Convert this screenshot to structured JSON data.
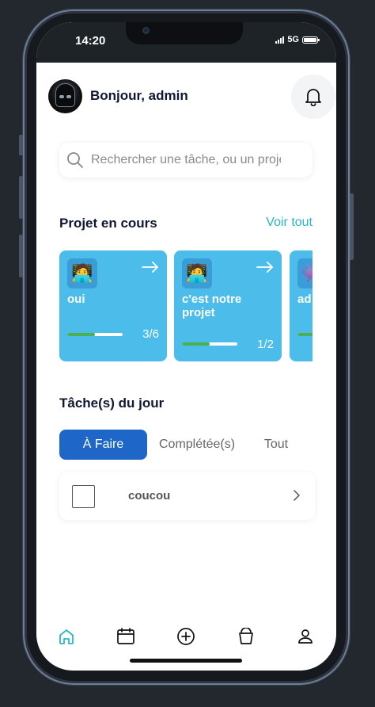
{
  "status_bar": {
    "time": "14:20",
    "network": "5G"
  },
  "header": {
    "greeting": "Bonjour, admin"
  },
  "search": {
    "placeholder": "Rechercher une tâche, ou un projet"
  },
  "projects": {
    "title": "Projet en cours",
    "see_all": "Voir tout",
    "cards": [
      {
        "name": "oui",
        "count_label": "3/6",
        "progress": 0.5,
        "icon": "🧑‍💻"
      },
      {
        "name": "c'est notre projet",
        "count_label": "1/2",
        "progress": 0.5,
        "icon": "🧑‍💻"
      },
      {
        "name": "ad",
        "count_label": "",
        "progress": 0.3,
        "icon": "👾"
      }
    ]
  },
  "tasks": {
    "title": "Tâche(s) du jour",
    "tabs": [
      "À Faire",
      "Complétée(s)",
      "Tout"
    ],
    "active_tab": 0,
    "items": [
      {
        "title": "coucou"
      }
    ]
  },
  "nav": {
    "items": [
      "home-icon",
      "calendar-icon",
      "add-icon",
      "bucket-icon",
      "profile-icon"
    ],
    "active": 0
  },
  "colors": {
    "accent": "#2bb6c6",
    "card": "#4cbdea",
    "tab_active": "#1e66c8",
    "progress": "#4caf50"
  }
}
